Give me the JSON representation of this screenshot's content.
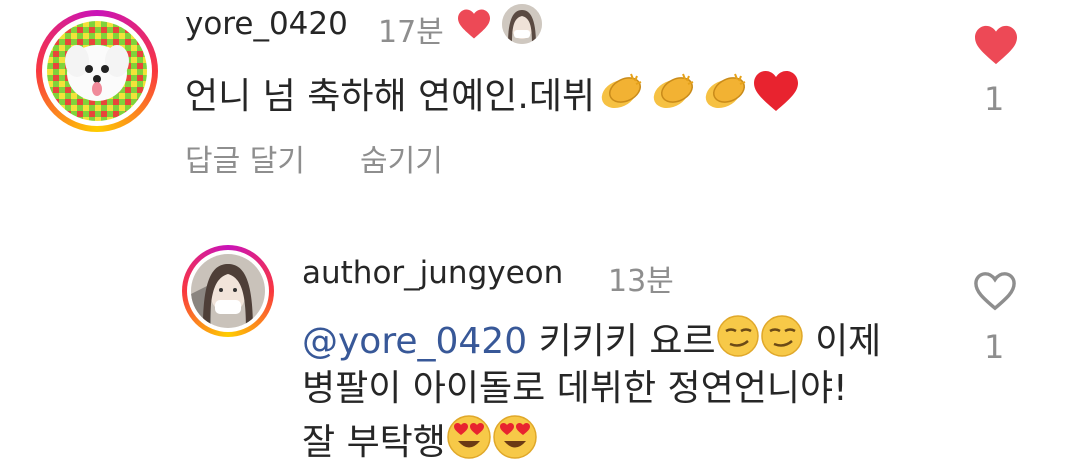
{
  "comments": [
    {
      "username": "yore_0420",
      "time": "17분",
      "text": "언니 넘 축하해 연예인.데뷔",
      "actions": {
        "reply": "답글 달기",
        "hide": "숨기기"
      },
      "like_count": "1",
      "liked": true
    },
    {
      "username": "author_jungyeon",
      "time": "13분",
      "mention": "@yore_0420",
      "line1": "키키키 요르",
      "line1_tail": "이제",
      "line2": "병팔이 아이돌로 데뷔한 정연언니야!",
      "line3": "잘 부탁행",
      "like_count": "1",
      "liked": false
    }
  ],
  "colors": {
    "like_red": "#ed4956",
    "mention_blue": "#385898",
    "muted": "#8e8e8e"
  },
  "icons": [
    "heart-filled-icon",
    "heart-outline-icon",
    "clapping-hands-emoji",
    "red-heart-emoji",
    "smirk-emoji",
    "heart-eyes-emoji"
  ]
}
